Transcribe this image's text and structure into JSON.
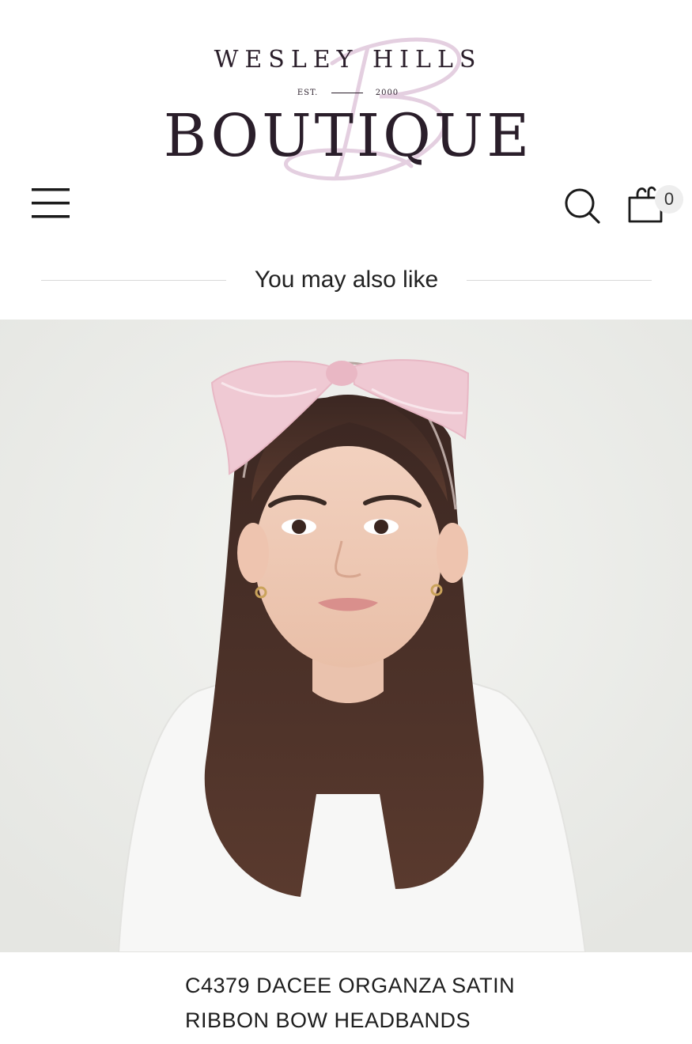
{
  "header": {
    "logo": {
      "top_text": "WESLEY HILLS",
      "est_label": "EST.",
      "est_year": "2000",
      "main_text": "BOUTIQUE",
      "monogram": "B",
      "monogram_color": "#e4cfe0",
      "text_color": "#2a1e2a"
    },
    "menu_icon": "hamburger-menu-icon",
    "search_icon": "search-icon",
    "cart": {
      "icon": "shopping-bag-icon",
      "count": "0"
    }
  },
  "section": {
    "title": "You may also like"
  },
  "product": {
    "image_description_icon": "product-photo",
    "title": "C4379 DACEE ORGANZA SATIN RIBBON BOW HEADBANDS",
    "bow_color": "#efc9d3",
    "background_color": "#ebece8"
  }
}
